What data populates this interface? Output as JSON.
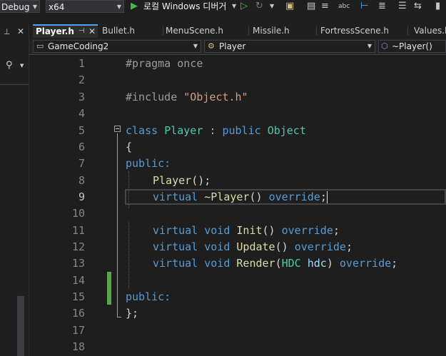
{
  "toolbar": {
    "config": "Debug",
    "platform": "x64",
    "run_label": "로컬 Windows 디버거"
  },
  "tabs": [
    {
      "label": "Player.h",
      "active": true
    },
    {
      "label": "Bullet.h"
    },
    {
      "label": "MenuScene.h"
    },
    {
      "label": "Missile.h"
    },
    {
      "label": "FortressScene.h"
    },
    {
      "label": "Values.h"
    }
  ],
  "navbar": {
    "project": "GameCoding2",
    "scope": "Player",
    "member": "~Player()"
  },
  "editor": {
    "line_numbers": [
      "1",
      "2",
      "3",
      "4",
      "5",
      "6",
      "7",
      "8",
      "9",
      "10",
      "11",
      "12",
      "13",
      "14",
      "15",
      "16",
      "17",
      "18"
    ],
    "current_line": 9,
    "tokens": {
      "l1_directive": "#pragma once",
      "l3_directive": "#include ",
      "l3_string": "\"Object.h\"",
      "l5_class": "class",
      "l5_name": "Player",
      "l5_colon": " : ",
      "l5_public": "public",
      "l5_base": "Object",
      "l6": "{",
      "l7": "public:",
      "l8_fn": "Player",
      "l8_rest": "();",
      "l9_virtual": "virtual",
      "l9_fn": "~Player",
      "l9_paren": "()",
      "l9_override": "override",
      "l9_semi": ";",
      "virtual": "virtual",
      "void": "void",
      "override": "override",
      "l11_fn": "Init",
      "l12_fn": "Update",
      "l13_fn": "Render",
      "l13_type": "HDC",
      "l13_param": "hdc",
      "paren_open": "(",
      "paren_close": ")",
      "empty_parens": "()",
      "semi": ";",
      "l15": "public:",
      "l16": "};"
    }
  },
  "colors": {
    "keyword": "#569cd6",
    "type": "#4ec9b0",
    "function": "#dcdcaa",
    "string": "#d69d85",
    "change_marker": "#57a64a",
    "tab_accent": "#4aa3ff"
  }
}
